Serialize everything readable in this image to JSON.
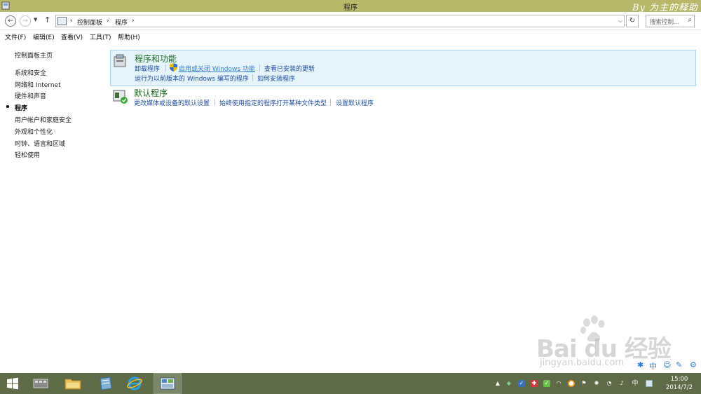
{
  "window": {
    "title": "程序",
    "watermark": "By 为主的释助"
  },
  "nav": {
    "back": "←",
    "forward": "→",
    "up": "↑",
    "breadcrumb": [
      "控制面板",
      "程序"
    ],
    "search_placeholder": "搜索控制...",
    "refresh": "↻"
  },
  "menu": [
    "文件(F)",
    "编辑(E)",
    "查看(V)",
    "工具(T)",
    "帮助(H)"
  ],
  "left_panel": {
    "home": "控制面板主页",
    "items": [
      "系统和安全",
      "网络和 Internet",
      "硬件和声音",
      "程序",
      "用户帐户和家庭安全",
      "外观和个性化",
      "时钟、语言和区域",
      "轻松使用"
    ],
    "current_index": 3
  },
  "categories": [
    {
      "title": "程序和功能",
      "links_row1": [
        "卸载程序",
        "启用或关闭 Windows 功能",
        "查看已安装的更新"
      ],
      "links_row2": [
        "运行为以前版本的 Windows 编写的程序",
        "如何安装程序"
      ]
    },
    {
      "title": "默认程序",
      "links_row1": [
        "更改媒体或设备的默认设置",
        "始终使用指定的程序打开某种文件类型",
        "设置默认程序"
      ]
    }
  ],
  "branding": {
    "baidu": "Bai du 经验",
    "baidu_url": "jingyan.baidu.com"
  },
  "ime": [
    "中"
  ],
  "tray": {
    "lang": "中",
    "time": "15:00",
    "date": "2014/7/2"
  },
  "colors": {
    "titlebar": "#b8b86a",
    "taskbar": "#5f6a47",
    "highlight_bg": "#e5f3fb",
    "category_title": "#1b6b1b",
    "link": "#1f4fa0"
  }
}
